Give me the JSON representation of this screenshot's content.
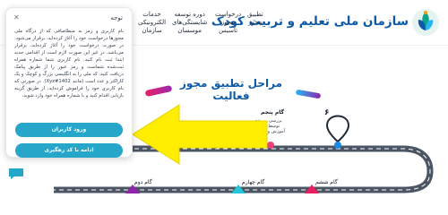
{
  "header": {
    "brand_title": "سازمان ملی تعلیم و تربیت کودک",
    "nav": [
      {
        "label": "تطبیق\nمجوز"
      },
      {
        "label": "درخواست\nمجوز\nتاسیس"
      },
      {
        "label": "دوره توسعه\nشایستگی‌های\nموسسان"
      },
      {
        "label": "خدمات\nالکترونیکی\nسازمان"
      }
    ]
  },
  "main": {
    "title": "مراحل تطبیق مجوز فعالیت",
    "steps": [
      {
        "number": "۶",
        "label": "گام ششم"
      },
      {
        "number": "",
        "label": "گام پنجم",
        "desc": "بررسی پرونده\nتوسط اداره\nآموزش و پرورش"
      },
      {
        "number": "",
        "label": "گام چهارم"
      },
      {
        "number": "",
        "label": "گام دوم"
      }
    ]
  },
  "panel": {
    "title": "توجه",
    "body": "نام کاربری و رمز به منظاضافی که از درگاه ملی مجوزها درخواست خود را آغاز کرده‌اید، برقرار می‌شود. در صورت درخواست خود را آغاز کرده‌اید، برقرار می‌باشد. در غیر این صورت لازم است از اقدامی جدید ابتدا ثبت نام کنید. نام کاربری شما شماره همراه ثبت‌شده شماست و رمز عبور را از طریق پیامک دریافت کنید. کد ملی را به انگلیسی بزرگ و کوچک و یک کاراکتر و عدد است (مانند Xyz#1402). در صورتی که نام کاربری خود را فراموش کرده‌اید، از طریق گزینه بازیابی اقدام کنید و با شماره همراه خود وارد شوید.",
    "login_button": "ورود کاربران",
    "continue_button": "ادامه با کد رهگیری"
  },
  "colors": {
    "brand": "#0e5aa7",
    "button": "#26a7c9",
    "arrow": "#ffee00"
  }
}
